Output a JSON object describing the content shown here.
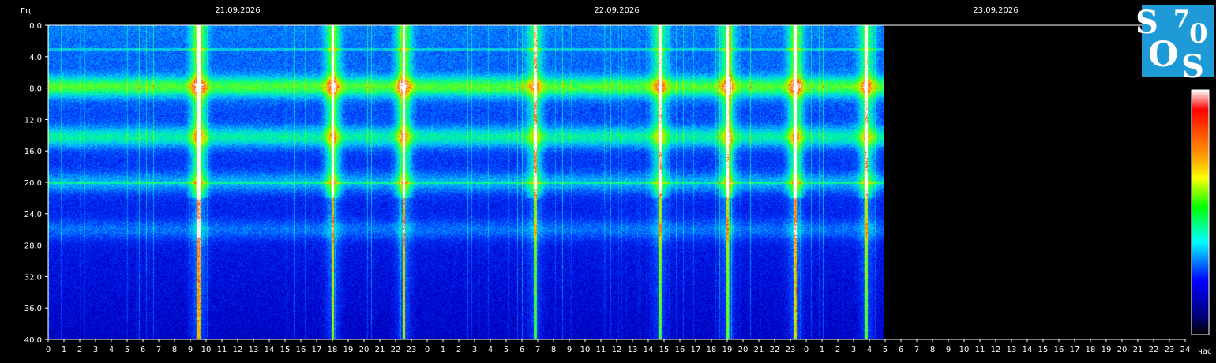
{
  "chart_data": {
    "type": "heatmap",
    "ylabel": "Гц",
    "xlabel": "час",
    "ylim": [
      40,
      0
    ],
    "yticks": [
      "0.0",
      "4.0",
      "8.0",
      "12.0",
      "16.0",
      "20.0",
      "24.0",
      "28.0",
      "32.0",
      "36.0",
      "40.0"
    ],
    "date_labels": [
      "21.09.2026",
      "22.09.2026",
      "23.09.2026"
    ],
    "xticks": [
      "0",
      "1",
      "2",
      "3",
      "4",
      "5",
      "6",
      "7",
      "8",
      "9",
      "10",
      "11",
      "12",
      "13",
      "14",
      "15",
      "16",
      "17",
      "18",
      "19",
      "20",
      "21",
      "22",
      "23",
      "0",
      "1",
      "2",
      "3",
      "4",
      "5",
      "6",
      "7",
      "8",
      "9",
      "10",
      "11",
      "12",
      "13",
      "14",
      "15",
      "16",
      "17",
      "18",
      "19",
      "20",
      "21",
      "22",
      "23",
      "0",
      "1",
      "2",
      "3",
      "4",
      "5",
      "6",
      "7",
      "8",
      "9",
      "10",
      "11",
      "12",
      "13",
      "14",
      "15",
      "16",
      "17",
      "18",
      "19",
      "20",
      "21",
      "22",
      "23",
      "24"
    ],
    "xlim_hours": [
      0,
      72
    ],
    "data_end_hours": 52.9,
    "resonance_bands_hz": [
      {
        "hz": 7.8,
        "level": 0.72
      },
      {
        "hz": 14.2,
        "level": 0.55
      },
      {
        "hz": 20.0,
        "level": 0.38
      },
      {
        "hz": 26.0,
        "level": 0.28
      }
    ],
    "interference_lines_hz": [
      3.0,
      20.0
    ],
    "bursts": [
      {
        "hour": 9.5,
        "level": 1.0
      },
      {
        "hour": 18.0,
        "level": 0.85
      },
      {
        "hour": 22.5,
        "level": 0.9
      },
      {
        "hour": 30.8,
        "level": 0.7
      },
      {
        "hour": 38.7,
        "level": 0.75
      },
      {
        "hour": 43.0,
        "level": 0.8
      },
      {
        "hour": 47.3,
        "level": 0.9
      },
      {
        "hour": 51.8,
        "level": 0.75
      }
    ],
    "colorscale": [
      "#ffffff",
      "#ff0000",
      "#ffa500",
      "#ffff00",
      "#00ff00",
      "#00ffff",
      "#0000ff",
      "#000080",
      "#000000"
    ],
    "grid": false,
    "legend": "colorbar-right"
  },
  "logo": {
    "letters": [
      "S",
      "7",
      "0",
      "O",
      "S"
    ],
    "color": "#1e9bd6"
  }
}
